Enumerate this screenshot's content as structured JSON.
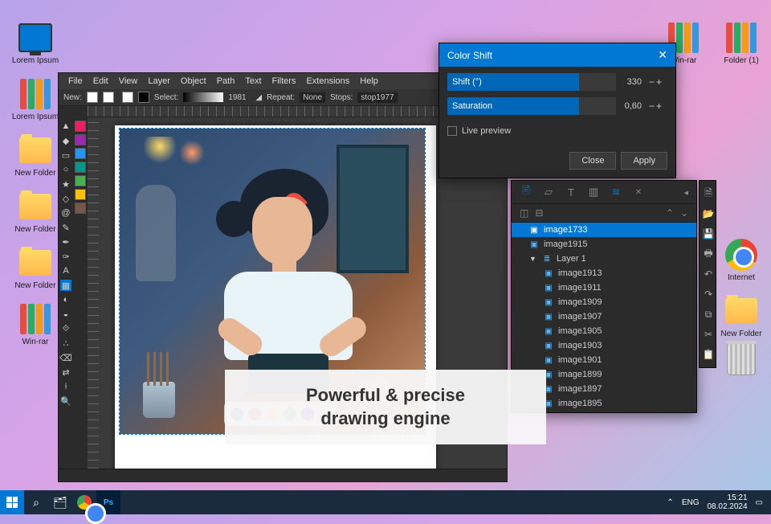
{
  "desktop": {
    "icons_left": [
      {
        "type": "pc",
        "label": "Lorem Ipsum"
      },
      {
        "type": "binder",
        "label": "Lorem Ipsum"
      },
      {
        "type": "folder",
        "label": "New Folder"
      },
      {
        "type": "folder",
        "label": "New Folder"
      },
      {
        "type": "folder",
        "label": "New Folder"
      },
      {
        "type": "binder",
        "label": "Win-rar"
      }
    ],
    "icons_right": [
      {
        "type": "binder",
        "label": "Win-rar"
      },
      {
        "type": "binder",
        "label": "Folder (1)"
      },
      {
        "type": "chrome",
        "label": "Internet"
      },
      {
        "type": "folder",
        "label": "New Folder"
      },
      {
        "type": "trash",
        "label": ""
      }
    ]
  },
  "app": {
    "menu": [
      "File",
      "Edit",
      "View",
      "Layer",
      "Object",
      "Path",
      "Text",
      "Filters",
      "Extensions",
      "Help"
    ],
    "toolbar": {
      "new_label": "New:",
      "select_label": "Select:",
      "select_value": "1981",
      "repeat_label": "Repeat:",
      "repeat_value": "None",
      "stops_label": "Stops:",
      "stops_value": "stop1977"
    }
  },
  "color_shift": {
    "title": "Color Shift",
    "shift_label": "Shift (°)",
    "shift_value": "330",
    "saturation_label": "Saturation",
    "saturation_value": "0,60",
    "live_preview": "Live preview",
    "close": "Close",
    "apply": "Apply"
  },
  "layers": {
    "items": [
      {
        "kind": "img",
        "label": "image1733",
        "depth": 0,
        "selected": true
      },
      {
        "kind": "img",
        "label": "image1915",
        "depth": 0
      },
      {
        "kind": "layer",
        "label": "Layer 1",
        "depth": 0,
        "expanded": true
      },
      {
        "kind": "img",
        "label": "image1913",
        "depth": 1
      },
      {
        "kind": "img",
        "label": "image1911",
        "depth": 1
      },
      {
        "kind": "img",
        "label": "image1909",
        "depth": 1
      },
      {
        "kind": "img",
        "label": "image1907",
        "depth": 1
      },
      {
        "kind": "img",
        "label": "image1905",
        "depth": 1
      },
      {
        "kind": "img",
        "label": "image1903",
        "depth": 1
      },
      {
        "kind": "img",
        "label": "image1901",
        "depth": 1
      },
      {
        "kind": "img",
        "label": "image1899",
        "depth": 1
      },
      {
        "kind": "img",
        "label": "image1897",
        "depth": 1
      },
      {
        "kind": "img",
        "label": "image1895",
        "depth": 1
      }
    ]
  },
  "caption": {
    "line1": "Powerful & precise",
    "line2": "drawing engine"
  },
  "taskbar": {
    "lang": "ENG",
    "time": "15:21",
    "date": "08.02.2024"
  }
}
